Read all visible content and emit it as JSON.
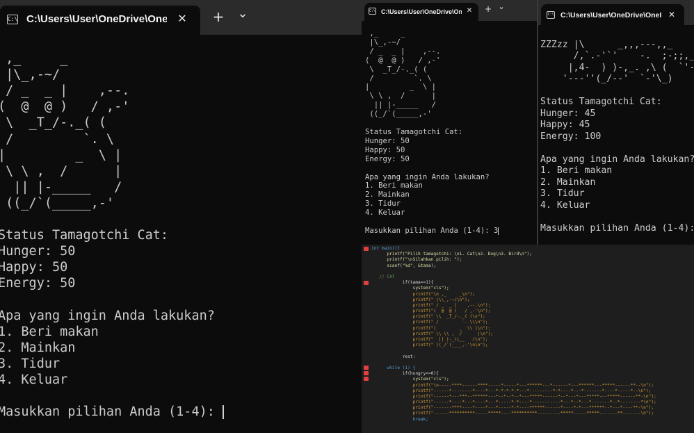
{
  "window_left": {
    "tab_title": "C:\\Users\\User\\OneDrive\\OneI",
    "icon_glyph": "C:\\",
    "close_glyph": "✕",
    "new_tab_glyph": "+",
    "dropdown_glyph": "⌄",
    "lines": [
      "",
      " ,_     _",
      " |\\_,-~/",
      " / _  _ |    ,--.",
      "(  @  @ )   / ,-'",
      " \\  _T_/-._( (",
      " /         `. \\",
      "|         _  \\ |",
      " \\ \\ ,  /      |",
      "  || |-_____   /",
      " ((_/`(_____,-'",
      "",
      "Status Tamagotchi Cat:",
      "Hunger: 50",
      "Happy: 50",
      "Energy: 50",
      "",
      "Apa yang ingin Anda lakukan?",
      "1. Beri makan",
      "2. Mainkan",
      "3. Tidur",
      "4. Keluar",
      "",
      "Masukkan pilihan Anda (1-4): "
    ]
  },
  "window_middle": {
    "tab_title": "C:\\Users\\User\\OneDrive\\OneI",
    "icon_glyph": "C:\\",
    "close_glyph": "✕",
    "new_tab_glyph": "+",
    "dropdown_glyph": "⌄",
    "lines": [
      " ,_     _",
      " |\\_,-~/",
      " / _  _ |    ,--.",
      "(  @  @ )   / ,-'",
      " \\  _T_/-._( (",
      " /         `. \\",
      "|         _  \\ |",
      " \\ \\ ,  /      |",
      "  || |-_____   /",
      " ((_/`(_____,-'",
      "",
      "Status Tamagotchi Cat:",
      "Hunger: 50",
      "Happy: 50",
      "Energy: 50",
      "",
      "Apa yang ingin Anda lakukan?",
      "1. Beri makan",
      "2. Mainkan",
      "3. Tidur",
      "4. Keluar",
      "",
      "Masukkan pilihan Anda (1-4): 3"
    ]
  },
  "window_right": {
    "tab_title": "C:\\Users\\User\\OneDrive\\OneI",
    "icon_glyph": "C:\\",
    "close_glyph": "✕",
    "lines": [
      "",
      "ZZZzz |\\      _,,,---,,_",
      "      /,`.-'`'    -.  ;-;;,_",
      "     |,4-  ) )-,_. ,\\ (  `'-'",
      "    '---''(_/--'  `-'\\_)",
      "",
      "Status Tamagotchi Cat:",
      "Hunger: 45",
      "Happy: 45",
      "Energy: 100",
      "",
      "Apa yang ingin Anda lakukan?",
      "1. Beri makan",
      "2. Mainkan",
      "3. Tidur",
      "4. Keluar",
      "",
      "Masukkan pilihan Anda (1-4):"
    ]
  },
  "editor": {
    "lines": [
      {
        "t": "int main(){",
        "c": "kw"
      },
      {
        "t": "      printf(\"Pilih tamagotchi: \\n1. Cat\\n2. Dog\\n3. Bird\\n\");",
        "c": "fn"
      },
      {
        "t": "      printf(\"\\nSilahkan pilih: \");",
        "c": "fn"
      },
      {
        "t": "      scanf(\"%d\", &tama);",
        "c": "fn"
      },
      {
        "t": "",
        "c": "pl"
      },
      {
        "t": "   // CAT",
        "c": "cm"
      },
      {
        "t": "            if(tama==1){",
        "c": "pl"
      },
      {
        "t": "                system(\"cls\");",
        "c": "fn"
      },
      {
        "t": "                printf(\"\\n ,_     _\\n\");",
        "c": "str"
      },
      {
        "t": "                printf(\" |\\\\_,-~/\\n\");",
        "c": "str"
      },
      {
        "t": "                printf(\" / _  _ |    ,--.\\n\");",
        "c": "str"
      },
      {
        "t": "                printf(\"(  @  @ )   / ,-'\\n\");",
        "c": "str"
      },
      {
        "t": "                printf(\" \\\\  _T_/-._( (\\n\");",
        "c": "str"
      },
      {
        "t": "                printf(\" /         `. \\\\\\n\");",
        "c": "str"
      },
      {
        "t": "                printf(\"|         _  \\\\ |\\n\");",
        "c": "str"
      },
      {
        "t": "                printf(\" \\\\ \\\\ ,  /      |\\n\");",
        "c": "str"
      },
      {
        "t": "                printf(\"  || |-_\\\\__   /\\n\");",
        "c": "str"
      },
      {
        "t": "                printf(\" ((_/`(____,-'\\n\\n\");",
        "c": "str"
      },
      {
        "t": "",
        "c": "pl"
      },
      {
        "t": "            rest:",
        "c": "pl"
      },
      {
        "t": "",
        "c": "pl"
      },
      {
        "t": "      while (1) {",
        "c": "kw"
      },
      {
        "t": "            if(hungry<=0){",
        "c": "pl"
      },
      {
        "t": "                system(\"cls\");",
        "c": "fn"
      },
      {
        "t": "                printf(\"\\n-----****------****-----*-----*---******---*------*---******---*****------**--\\n\");",
        "c": "str"
      },
      {
        "t": "                printf(\"------*--------*----*---*-*-*-*-*---*---------*-*----*---*-------*----*-----*--\\n\");",
        "c": "str"
      },
      {
        "t": "                printf(\"------*---***--******---*--*--*--*---*****------*--*---*---*****---*****------**-\\n\");",
        "c": "str"
      },
      {
        "t": "                printf(\"------*----*---*----*---*-----*-*----*-----------*---*--*---*-------*--*--------*\\n\");",
        "c": "str"
      },
      {
        "t": "                printf(\"-------****----*----*---*-----*-*----******------*----*-*---******--*---*----**-\\n\");",
        "c": "str"
      },
      {
        "t": "                printf(\"------**********-----*****----**********---------*****-----*****-------**-------\\n\");",
        "c": "str"
      },
      {
        "t": "                break;",
        "c": "kw"
      }
    ]
  }
}
